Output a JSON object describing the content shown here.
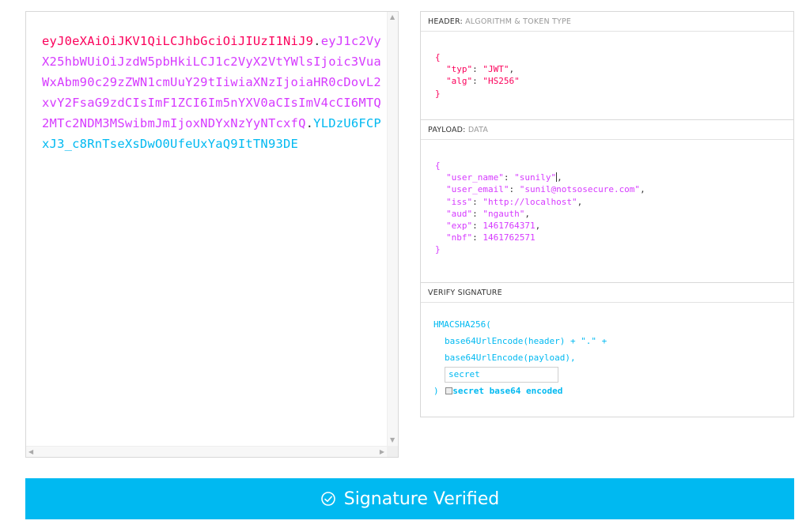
{
  "encoded": {
    "header": "eyJ0eXAiOiJKV1QiLCJhbGciOiJIUzI1NiJ9",
    "payload": "eyJ1c2VyX25hbWUiOiJzdW5pbHkiLCJ1c2VyX2VtYWlsIjoic3VuaWxAbm90c29zZWN1cmUuY29tIiwiaXNzIjoiaHR0cDovL2xvY2FsaG9zdCIsImF1ZCI6Im5nYXV0aCIsImV4cCI6MTQ2MTc2NDM3MSwibmJmIjoxNDYxNzYyNTcxfQ",
    "signature": "YLDzU6FCPxJ3_c8RnTseXsDwO0UfeUxYaQ9ItTN93DE",
    "dot": "."
  },
  "header_section": {
    "title": "HEADER:",
    "subtitle": "ALGORITHM & TOKEN TYPE",
    "open": "{",
    "close": "}",
    "fields": [
      {
        "key": "\"typ\"",
        "value": "\"JWT\"",
        "sep": ": ",
        "trail": ","
      },
      {
        "key": "\"alg\"",
        "value": "\"HS256\"",
        "sep": ": ",
        "trail": ""
      }
    ]
  },
  "payload_section": {
    "title": "PAYLOAD:",
    "subtitle": "DATA",
    "open": "{",
    "close": "}",
    "fields": [
      {
        "key": "\"user_name\"",
        "value": "\"sunily\"",
        "sep": ": ",
        "trail": ","
      },
      {
        "key": "\"user_email\"",
        "value": "\"sunil@notsosecure.com\"",
        "sep": ": ",
        "trail": ","
      },
      {
        "key": "\"iss\"",
        "value": "\"http://localhost\"",
        "sep": ": ",
        "trail": ","
      },
      {
        "key": "\"aud\"",
        "value": "\"ngauth\"",
        "sep": ": ",
        "trail": ","
      },
      {
        "key": "\"exp\"",
        "value": "1461764371",
        "sep": ": ",
        "trail": ","
      },
      {
        "key": "\"nbf\"",
        "value": "1461762571",
        "sep": ": ",
        "trail": ""
      }
    ]
  },
  "verify_section": {
    "title": "VERIFY SIGNATURE",
    "func": "HMACSHA256(",
    "line1": "base64UrlEncode(header) + \".\" +",
    "line2": "base64UrlEncode(payload),",
    "secret_value": "secret",
    "close": ")",
    "checkbox_label": "secret base64 encoded"
  },
  "banner": {
    "label": "Signature Verified",
    "color": "#00b9f1"
  },
  "colors": {
    "header": "#fb015b",
    "payload": "#d63aff",
    "signature": "#00b9f1"
  }
}
